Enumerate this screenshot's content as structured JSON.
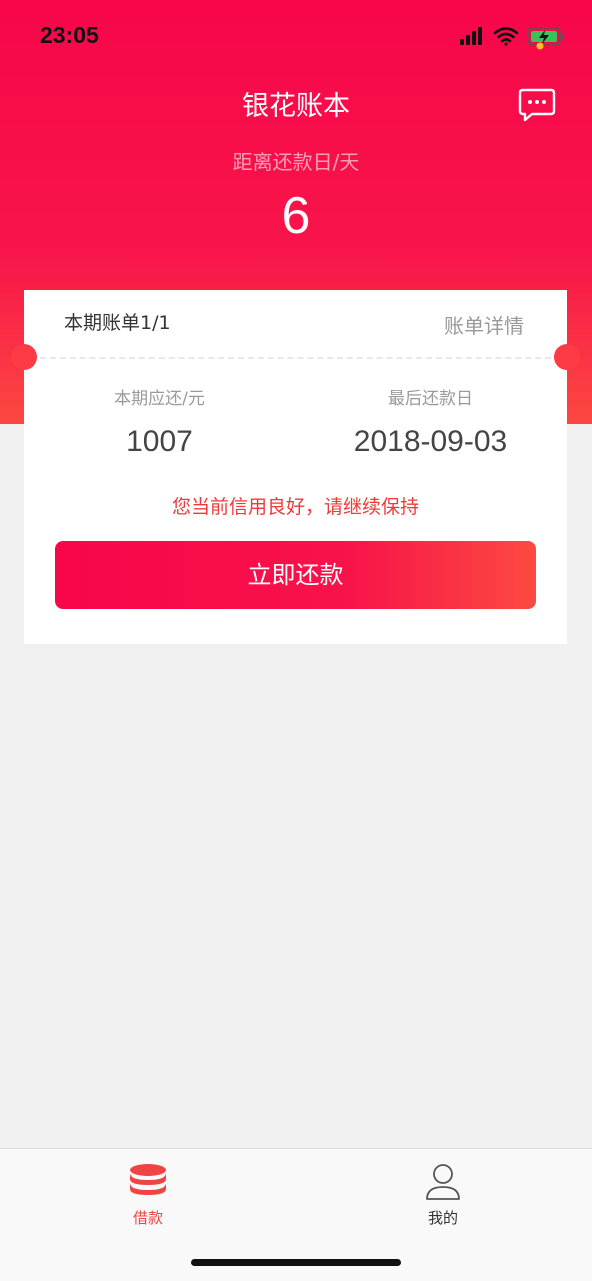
{
  "status_bar": {
    "time": "23:05",
    "signal_icon": "cellular-signal-icon",
    "wifi_icon": "wifi-icon",
    "battery_icon": "battery-charging-icon"
  },
  "header": {
    "title": "银花账本",
    "message_icon": "chat-bubble-icon",
    "countdown_label": "距离还款日/天",
    "countdown_value": "6"
  },
  "bill_card": {
    "period_label": "本期账单1/1",
    "detail_link": "账单详情",
    "amount_label": "本期应还/元",
    "amount_value": "1007",
    "due_label": "最后还款日",
    "due_value": "2018-09-03",
    "credit_message": "您当前信用良好，请继续保持",
    "repay_button": "立即还款"
  },
  "tabbar": {
    "loan_label": "借款",
    "loan_icon": "coins-stack-icon",
    "mine_label": "我的",
    "mine_icon": "user-icon"
  },
  "colors": {
    "brand_red": "#f7064a",
    "brand_orange": "#fc4840",
    "credit_message": "#ef3a3a",
    "tab_active": "#ef4444"
  }
}
